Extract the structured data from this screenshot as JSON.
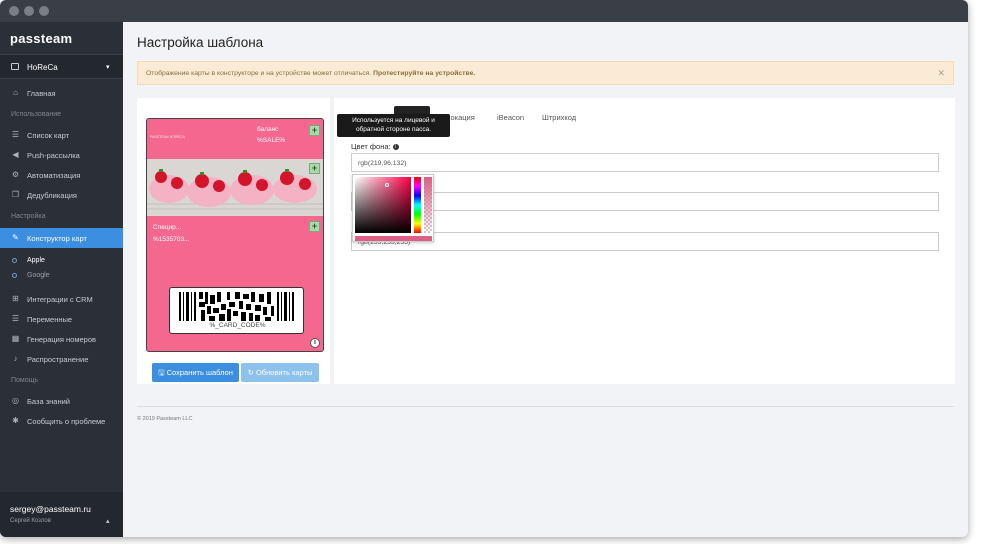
{
  "sidebar": {
    "logo": "passteam",
    "org": "HoReCa",
    "sections": {
      "usage": "Использование",
      "settings": "Настройка",
      "help": "Помощь"
    },
    "items": {
      "home": "Главная",
      "cards": "Список карт",
      "push": "Push-рассылка",
      "automation": "Автоматизация",
      "dedup": "Дедубликация",
      "constructor": "Конструктор карт",
      "apple": "Apple",
      "google": "Google",
      "crm": "Интеграции с CRM",
      "variables": "Переменные",
      "numbers": "Генерация номеров",
      "distribution": "Распространение",
      "kb": "База знаний",
      "report": "Сообщить о проблеме"
    },
    "user": {
      "email": "sergey@passteam.ru",
      "name": "Сергей Козлов"
    }
  },
  "page": {
    "title": "Настройка шаблона",
    "alert": {
      "text": "Отображение карты в конструкторе и на устройстве может отличаться.",
      "strong": "Протестируйте на устройстве."
    }
  },
  "card": {
    "logo_text": "PASSTEAM HORECA",
    "balance_label": "баланс",
    "balance_value": "%SALE%",
    "secondary_label": "Специр...",
    "secondary_value": "%1535703...",
    "barcode_text": "%_CARD_CODE%",
    "background_color": "#db6084"
  },
  "buttons": {
    "save": "Сохранить шаблон",
    "update": "Обновить карты"
  },
  "tabs": {
    "location": "локация",
    "ibeacon": "iBeacon",
    "barcode": "Штрихкод"
  },
  "tooltip": {
    "line1": "Используется на лицевой и",
    "line2": "обратной стороне пасса."
  },
  "form": {
    "bg_label": "Цвет фона:",
    "bg_value": "rgb(219,96,132)",
    "second_value": "",
    "third_value": "rgb(255,255,255)"
  },
  "footer": {
    "copyright": "© 2019 Passteam LLC"
  }
}
